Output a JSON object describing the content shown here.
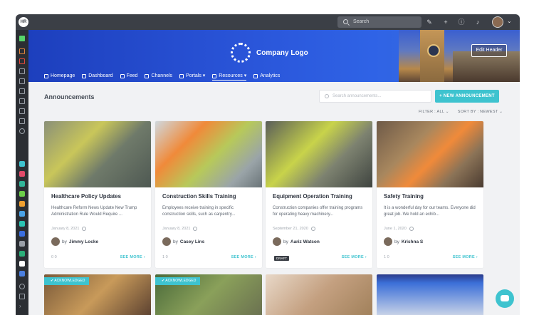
{
  "app": {
    "badge": "HR"
  },
  "topbar": {
    "search_placeholder": "Search"
  },
  "header": {
    "company_name": "Company Logo",
    "edit_label": "Edit Header",
    "nav": [
      {
        "label": "Homepage",
        "icon": "home-icon"
      },
      {
        "label": "Dashboard",
        "icon": "dashboard-icon"
      },
      {
        "label": "Feed",
        "icon": "feed-icon"
      },
      {
        "label": "Channels",
        "icon": "channels-icon"
      },
      {
        "label": "Portals ▾",
        "icon": "portals-icon"
      },
      {
        "label": "Resources ▾",
        "icon": "bookmark-icon"
      },
      {
        "label": "Analytics",
        "icon": "analytics-icon"
      }
    ]
  },
  "main": {
    "title": "Announcements",
    "search_placeholder": "Search announcements...",
    "new_button": "+ NEW ANNOUNCEMENT",
    "filter_label": "FILTER : ALL ⌄",
    "sort_label": "SORT BY : NEWEST ⌄",
    "cards": [
      {
        "title": "Healthcare Policy Updates",
        "excerpt": "Healthcare Reform News Update New Trump Administration Rule Would Require ...",
        "date": "January 8, 2021",
        "author_prefix": "by",
        "author": "Jimmy Locke",
        "stats": "0 0",
        "see_more": "SEE MORE ›"
      },
      {
        "title": "Construction Skills Training",
        "excerpt": "Employees receive training in specific construction skills, such as carpentry...",
        "date": "January 8, 2021",
        "author_prefix": "by",
        "author": "Casey Lins",
        "stats": "1 0",
        "see_more": "SEE MORE ›"
      },
      {
        "title": "Equipment Operation Training",
        "excerpt": "Construction companies offer training programs for operating heavy machinery...",
        "date": "September 21, 2020",
        "author_prefix": "by",
        "author": "Aariz Watson",
        "draft": "DRAFT",
        "see_more": "SEE MORE ›"
      },
      {
        "title": "Safety Training",
        "excerpt": "It is a wonderful day for our teams. Everyone did great job. We hold an exhib...",
        "date": "June 1, 2020",
        "author_prefix": "by",
        "author": "Krishna S",
        "stats": "1 0",
        "see_more": "SEE MORE ›"
      }
    ],
    "ack_label": "✔ ACKNOWLEDGED"
  },
  "colors": {
    "accent": "#3ec3cf",
    "topbar": "#3b3f46",
    "banner": "#2a55d9"
  }
}
